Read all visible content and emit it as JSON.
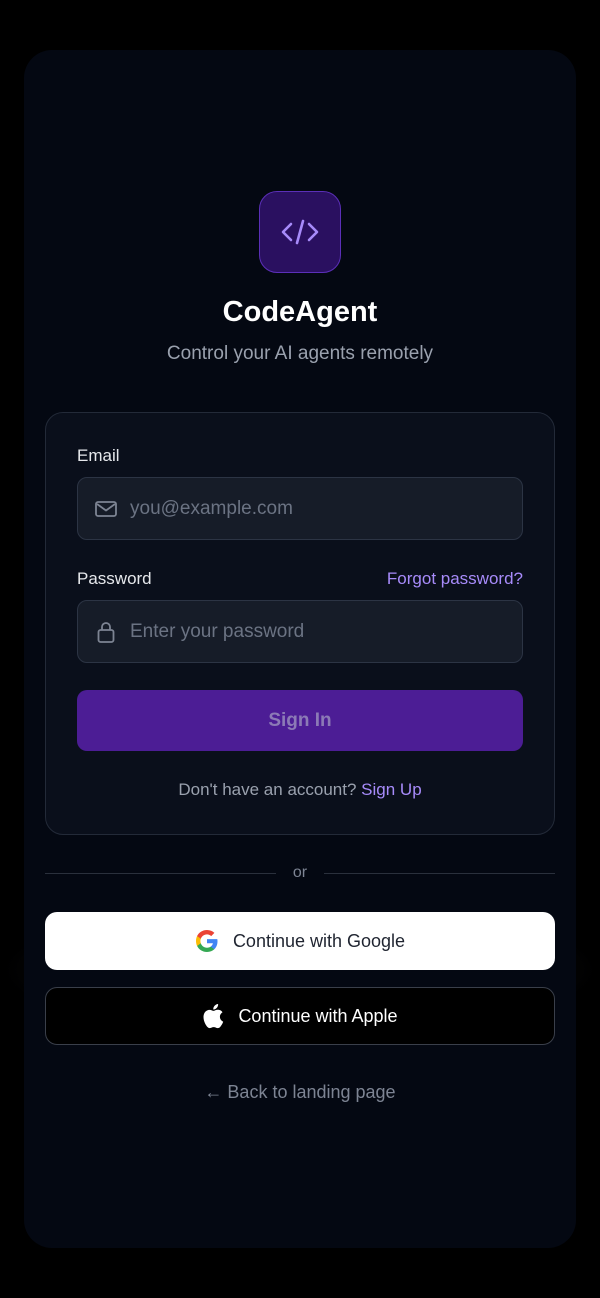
{
  "app": {
    "title": "CodeAgent",
    "subtitle": "Control your AI agents remotely",
    "logo_icon": "code-brackets-icon"
  },
  "form": {
    "email_label": "Email",
    "email_placeholder": "you@example.com",
    "email_value": "",
    "password_label": "Password",
    "password_placeholder": "Enter your password",
    "password_value": "",
    "forgot_label": "Forgot password?",
    "signin_label": "Sign In",
    "no_account_text": "Don't have an account?",
    "signup_label": "Sign Up"
  },
  "divider": {
    "text": "or"
  },
  "social": {
    "google_label": "Continue with Google",
    "apple_label": "Continue with Apple"
  },
  "back": {
    "label": "← Back to landing page"
  },
  "colors": {
    "accent": "#a78bfa",
    "primary_button": "#4c1d95",
    "background": "#040812"
  }
}
